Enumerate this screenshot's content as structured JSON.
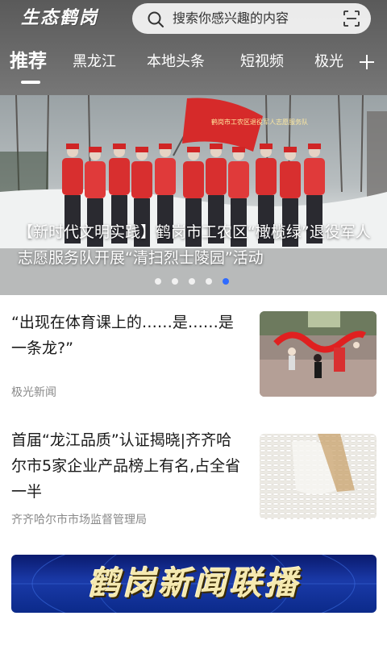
{
  "header": {
    "logo_text": "生态鹤岗",
    "search_placeholder": "搜索你感兴趣的内容"
  },
  "tabs": [
    {
      "label": "推荐",
      "active": true
    },
    {
      "label": "黑龙江",
      "active": false
    },
    {
      "label": "本地头条",
      "active": false
    },
    {
      "label": "短视频",
      "active": false
    },
    {
      "label": "极光",
      "active": false
    }
  ],
  "hero": {
    "caption": "【新时代文明实践】鹤岗市工农区“橄榄绿”退役军人志愿服务队开展“清扫烈士陵园”活动",
    "banner_flag_text": "鹤岗市工农区退役军人志愿服务队",
    "slide_count": 5,
    "active_slide": 5
  },
  "news": [
    {
      "title": "“出现在体育课上的……是……是一条龙?”",
      "source": "极光新闻"
    },
    {
      "title": "首届“龙江品质”认证揭晓|齐齐哈尔市5家企业产品榜上有名,占全省一半",
      "source": "齐齐哈尔市市场监督管理局"
    }
  ],
  "promo_banner": {
    "text": "鹤岗新闻联播"
  },
  "colors": {
    "header_bg": "#6b6b6b",
    "active_dot": "#2f6bff",
    "banner_blue": "#1a3aa8",
    "banner_text": "#f5e9b0"
  }
}
